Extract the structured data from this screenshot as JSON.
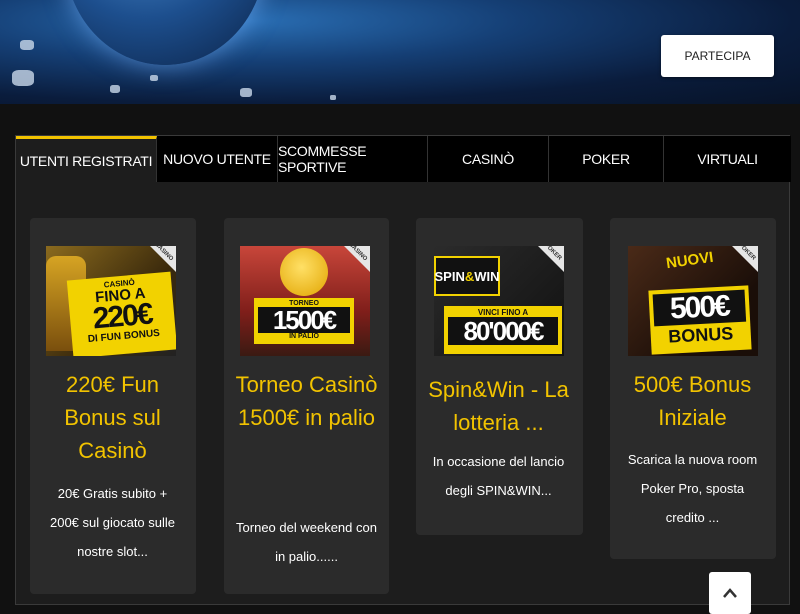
{
  "header": {
    "cta_label": "PARTECIPA"
  },
  "tabs": [
    {
      "label": "UTENTI REGISTRATI",
      "active": true
    },
    {
      "label": "NUOVO UTENTE",
      "active": false
    },
    {
      "label": "SCOMMESSE SPORTIVE",
      "active": false
    },
    {
      "label": "CASINÒ",
      "active": false
    },
    {
      "label": "POKER",
      "active": false
    },
    {
      "label": "VIRTUALI",
      "active": false
    }
  ],
  "cards": [
    {
      "title": "220€ Fun Bonus sul Casinò",
      "desc": "20€ Gratis subito + 200€ sul giocato sulle nostre slot...",
      "banner": {
        "tag": "CASINO",
        "small": "CASINÒ",
        "line1": "FINO A",
        "big": "220€",
        "line3": "DI FUN BONUS"
      }
    },
    {
      "title": "Torneo Casinò 1500€ in palio",
      "desc": "Torneo del weekend con in palio......",
      "banner": {
        "tag": "CASINO",
        "small": "TORNEO",
        "big": "1500€",
        "line3": "IN PALIO"
      }
    },
    {
      "title": "Spin&Win - La lotteria ...",
      "desc": "In occasione del lancio degli SPIN&WIN...",
      "banner": {
        "tag": "POKER",
        "logo1": "SPIN",
        "logo2": "WIN",
        "small": "VINCI FINO A",
        "big": "80'000€"
      }
    },
    {
      "title": "500€ Bonus Iniziale",
      "desc": "Scarica la nuova room Poker Pro, sposta credito ...",
      "banner": {
        "tag": "POKER",
        "small": "NUOVI",
        "big": "500€",
        "line3": "BONUS"
      }
    }
  ],
  "colors": {
    "accent": "#f2c300",
    "card_bg": "#2b2b2b",
    "tabs_bg": "#000000"
  }
}
